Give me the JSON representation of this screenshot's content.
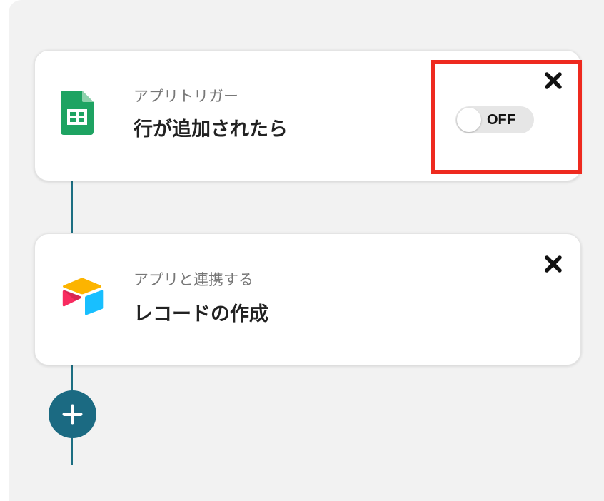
{
  "flow": {
    "steps": [
      {
        "app_icon": "google-sheets-icon",
        "subtitle": "アプリトリガー",
        "title": "行が追加されたら",
        "toggle_label": "OFF",
        "close_icon": "close-icon"
      },
      {
        "app_icon": "airtable-icon",
        "subtitle": "アプリと連携する",
        "title": "レコードの作成",
        "close_icon": "close-icon"
      }
    ],
    "add_icon": "plus-icon"
  },
  "colors": {
    "connector": "#1c6e82",
    "add_button": "#1b6a82",
    "highlight": "#ee2a1f",
    "sheets_green": "#1ea362",
    "canvas_bg": "#f2f2f2"
  }
}
